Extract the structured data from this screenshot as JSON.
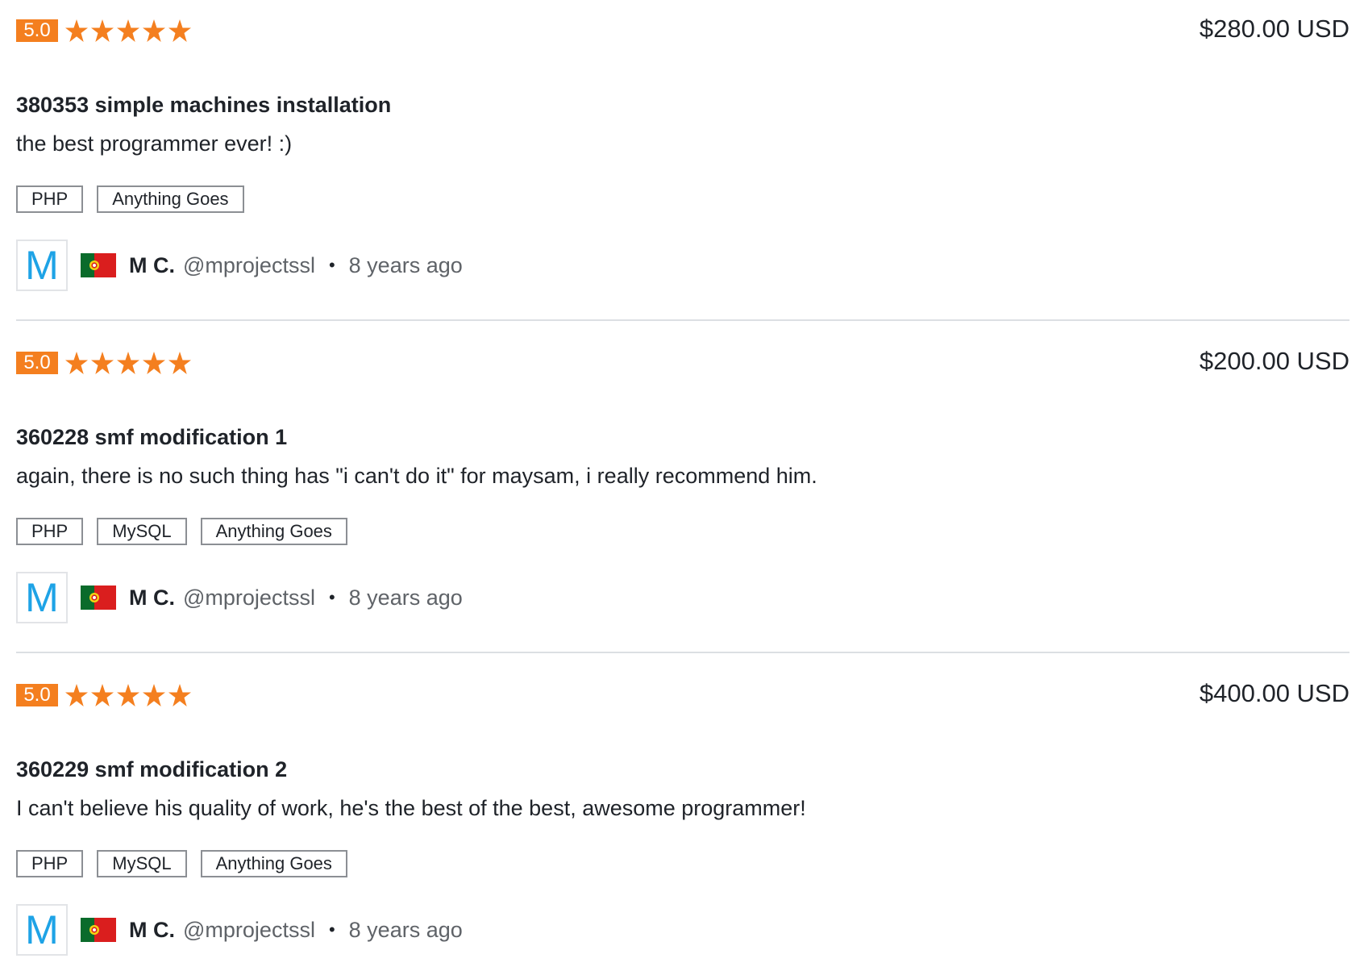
{
  "colors": {
    "rating_badge": "#f47f1f",
    "star": "#f47f1f",
    "avatar_letter": "#1ea3e6",
    "text_primary": "#1f2329",
    "text_muted": "#5f6368",
    "tag_border": "#8c8f94",
    "divider": "#dcdfe3"
  },
  "icons": {
    "star": "star-icon",
    "flag": "portugal-flag-icon",
    "separator": "bullet-dot"
  },
  "reviews": [
    {
      "rating": "5.0",
      "stars": 5,
      "price": "$280.00 USD",
      "title": "380353 simple machines installation",
      "comment": "the best programmer ever! :)",
      "tags": [
        "PHP",
        "Anything Goes"
      ],
      "reviewer": {
        "avatar_letter": "M",
        "name": "M C.",
        "handle": "@mprojectssl",
        "separator": "•",
        "time_ago": "8 years ago"
      }
    },
    {
      "rating": "5.0",
      "stars": 5,
      "price": "$200.00 USD",
      "title": "360228 smf modification 1",
      "comment": "again, there is no such thing has \"i can't do it\" for maysam, i really recommend him.",
      "tags": [
        "PHP",
        "MySQL",
        "Anything Goes"
      ],
      "reviewer": {
        "avatar_letter": "M",
        "name": "M C.",
        "handle": "@mprojectssl",
        "separator": "•",
        "time_ago": "8 years ago"
      }
    },
    {
      "rating": "5.0",
      "stars": 5,
      "price": "$400.00 USD",
      "title": "360229 smf modification 2",
      "comment": "I can't believe his quality of work, he's the best of the best, awesome programmer!",
      "tags": [
        "PHP",
        "MySQL",
        "Anything Goes"
      ],
      "reviewer": {
        "avatar_letter": "M",
        "name": "M C.",
        "handle": "@mprojectssl",
        "separator": "•",
        "time_ago": "8 years ago"
      }
    }
  ]
}
